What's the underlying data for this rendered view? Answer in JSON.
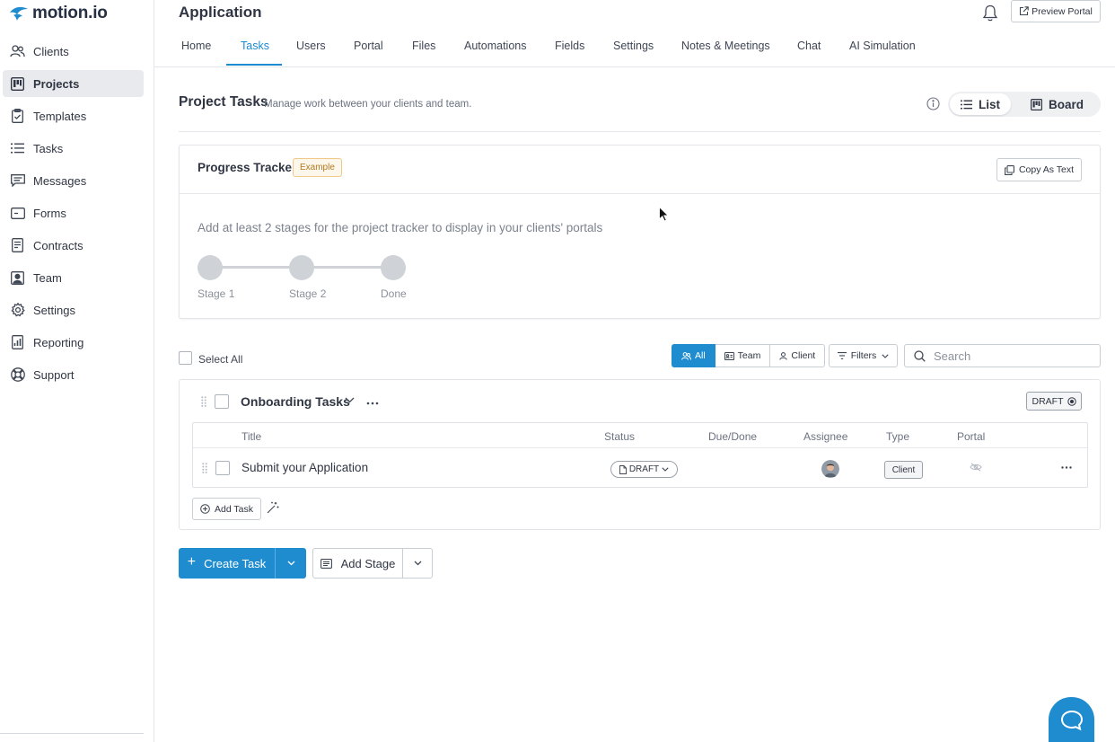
{
  "brand": {
    "name": "motion.io",
    "color": "#1f8ccf"
  },
  "sidebar": {
    "items": [
      {
        "label": "Clients",
        "icon": "users-icon"
      },
      {
        "label": "Projects",
        "icon": "projects-icon",
        "active": true
      },
      {
        "label": "Templates",
        "icon": "clipboard-icon"
      },
      {
        "label": "Tasks",
        "icon": "list-icon"
      },
      {
        "label": "Messages",
        "icon": "messages-icon"
      },
      {
        "label": "Forms",
        "icon": "forms-icon"
      },
      {
        "label": "Contracts",
        "icon": "contract-icon"
      },
      {
        "label": "Team",
        "icon": "team-icon"
      },
      {
        "label": "Settings",
        "icon": "gear-icon"
      },
      {
        "label": "Reporting",
        "icon": "chart-icon"
      },
      {
        "label": "Support",
        "icon": "lifebuoy-icon"
      }
    ]
  },
  "header": {
    "title": "Application",
    "preview_label": "Preview Portal",
    "tabs": [
      {
        "label": "Home"
      },
      {
        "label": "Tasks",
        "active": true
      },
      {
        "label": "Users"
      },
      {
        "label": "Portal"
      },
      {
        "label": "Files"
      },
      {
        "label": "Automations"
      },
      {
        "label": "Fields"
      },
      {
        "label": "Settings"
      },
      {
        "label": "Notes & Meetings"
      },
      {
        "label": "Chat"
      },
      {
        "label": "AI Simulation"
      }
    ]
  },
  "section": {
    "title": "Project Tasks",
    "subtitle": "Manage work between your clients and team.",
    "view_list": "List",
    "view_board": "Board"
  },
  "tracker": {
    "title": "Progress Tracker",
    "badge": "Example",
    "copy_label": "Copy As Text",
    "hint": "Add at least 2 stages for the project tracker to display in your clients' portals",
    "stages": [
      "Stage 1",
      "Stage 2",
      "Done"
    ]
  },
  "toolbar": {
    "select_all": "Select All",
    "segments": [
      {
        "label": "All",
        "active": true
      },
      {
        "label": "Team"
      },
      {
        "label": "Client"
      }
    ],
    "filters_label": "Filters",
    "search_placeholder": "Search"
  },
  "stage": {
    "name": "Onboarding Tasks",
    "status_badge": "DRAFT",
    "columns": [
      "Title",
      "Status",
      "Due/Done",
      "Assignee",
      "Type",
      "Portal"
    ],
    "tasks": [
      {
        "title": "Submit your Application",
        "status": "DRAFT",
        "due": "",
        "type": "Client"
      }
    ],
    "add_task_label": "Add Task"
  },
  "actions": {
    "create_task": "Create Task",
    "add_stage": "Add Stage"
  }
}
